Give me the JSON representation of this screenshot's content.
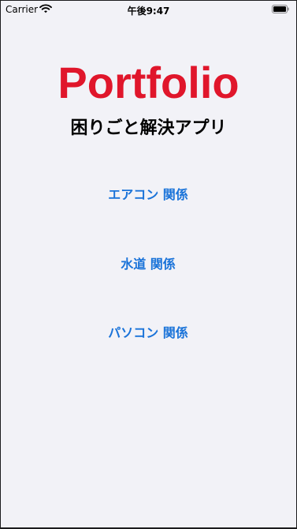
{
  "status_bar": {
    "carrier": "Carrier",
    "time": "午後9:47",
    "wifi_icon": "wifi-icon",
    "battery_icon": "battery-icon"
  },
  "header": {
    "title": "Portfolio",
    "subtitle": "困りごと解決アプリ"
  },
  "menu": {
    "items": [
      {
        "label": "エアコン 関係"
      },
      {
        "label": "水道 関係"
      },
      {
        "label": "パソコン 関係"
      }
    ]
  },
  "colors": {
    "title": "#e0162b",
    "link": "#1a73d9",
    "background": "#f2f2f7"
  }
}
